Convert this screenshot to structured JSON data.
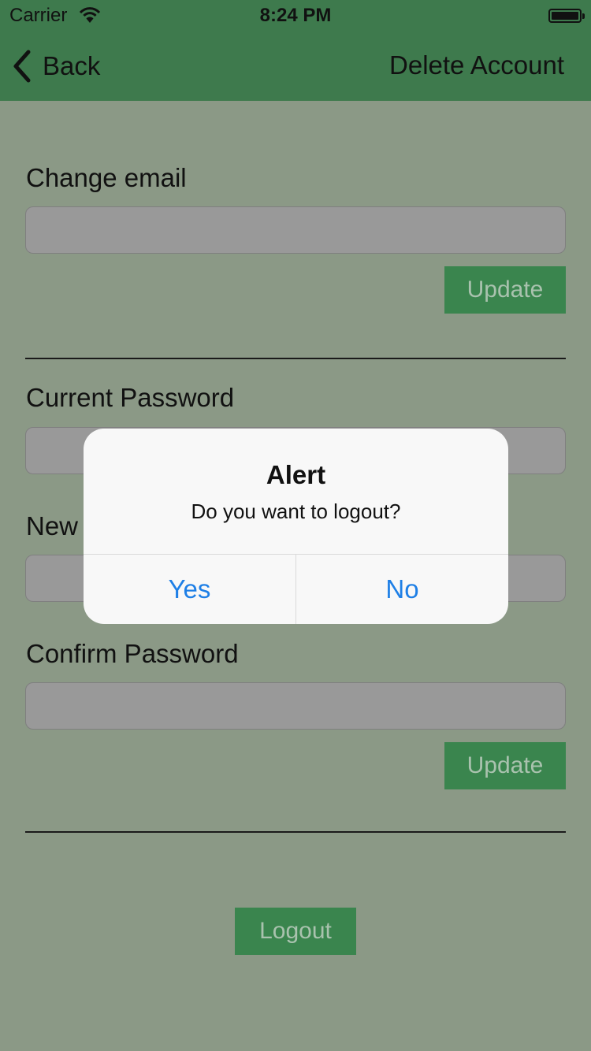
{
  "status_bar": {
    "carrier": "Carrier",
    "time": "8:24 PM"
  },
  "nav": {
    "back_label": "Back",
    "action_label": "Delete Account",
    "color": "#3e7a4d"
  },
  "email_section": {
    "label": "Change email",
    "value": "",
    "button_label": "Update"
  },
  "password_section": {
    "current_label": "Current Password",
    "new_label": "New Password",
    "confirm_label": "Confirm Password",
    "button_label": "Update"
  },
  "logout_label": "Logout",
  "alert": {
    "title": "Alert",
    "message": "Do you want to logout?",
    "yes_label": "Yes",
    "no_label": "No",
    "button_color": "#1e7fe6"
  },
  "icons": {
    "back": "chevron-left-icon",
    "wifi": "wifi-icon",
    "battery": "battery-icon"
  }
}
